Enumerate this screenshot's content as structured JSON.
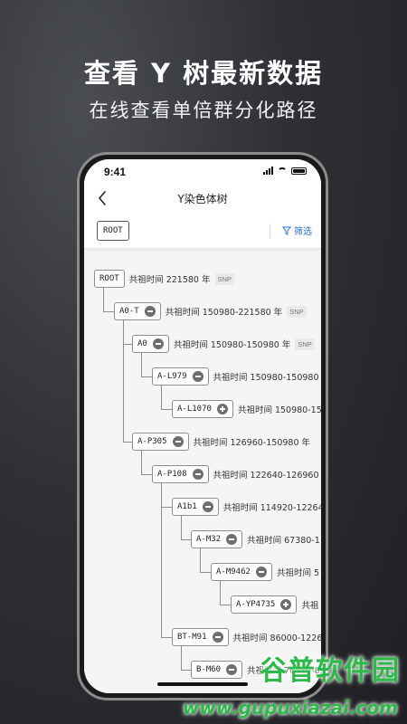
{
  "hero": {
    "title": "查看 Y 树最新数据",
    "subtitle": "在线查看单倍群分化路径"
  },
  "status_bar": {
    "time": "9:41"
  },
  "nav": {
    "title": "Y染色体树",
    "back_icon": "chevron-left-icon"
  },
  "filter_bar": {
    "root_chip": "ROOT",
    "filter_label": "筛选",
    "filter_icon": "funnel-icon"
  },
  "tree": {
    "snp_label": "SNP",
    "nodes": [
      {
        "id": "ROOT",
        "time": "共祖时间 221580 年",
        "snp": true,
        "toggle": "none"
      },
      {
        "id": "A0-T",
        "time": "共祖时间 150980-221580 年",
        "snp": true,
        "toggle": "collapse"
      },
      {
        "id": "A0",
        "time": "共祖时间 150980-150980 年",
        "snp": true,
        "toggle": "collapse"
      },
      {
        "id": "A-L979",
        "time": "共祖时间 150980-150980",
        "snp": false,
        "toggle": "collapse"
      },
      {
        "id": "A-L1070",
        "time": "共祖时间 150980-15",
        "snp": false,
        "toggle": "expand"
      },
      {
        "id": "A-P305",
        "time": "共祖时间 126960-150980 年",
        "snp": false,
        "toggle": "collapse"
      },
      {
        "id": "A-P108",
        "time": "共祖时间 122640-126960",
        "snp": false,
        "toggle": "collapse"
      },
      {
        "id": "A1b1",
        "time": "共祖时间 114920-12264",
        "snp": false,
        "toggle": "collapse"
      },
      {
        "id": "A-M32",
        "time": "共祖时间 67380-1",
        "snp": false,
        "toggle": "collapse"
      },
      {
        "id": "A-M9462",
        "time": "共祖时间 5",
        "snp": false,
        "toggle": "collapse"
      },
      {
        "id": "A-YP4735",
        "time": "共祖",
        "snp": false,
        "toggle": "expand"
      },
      {
        "id": "BT-M91",
        "time": "共祖时间 86000-1226",
        "snp": false,
        "toggle": "collapse"
      },
      {
        "id": "B-M60",
        "time": "共祖时间 76110-8",
        "snp": false,
        "toggle": "collapse"
      }
    ]
  },
  "watermark": {
    "text": "谷普软件园",
    "url": "www.gupuxiazai.com"
  }
}
